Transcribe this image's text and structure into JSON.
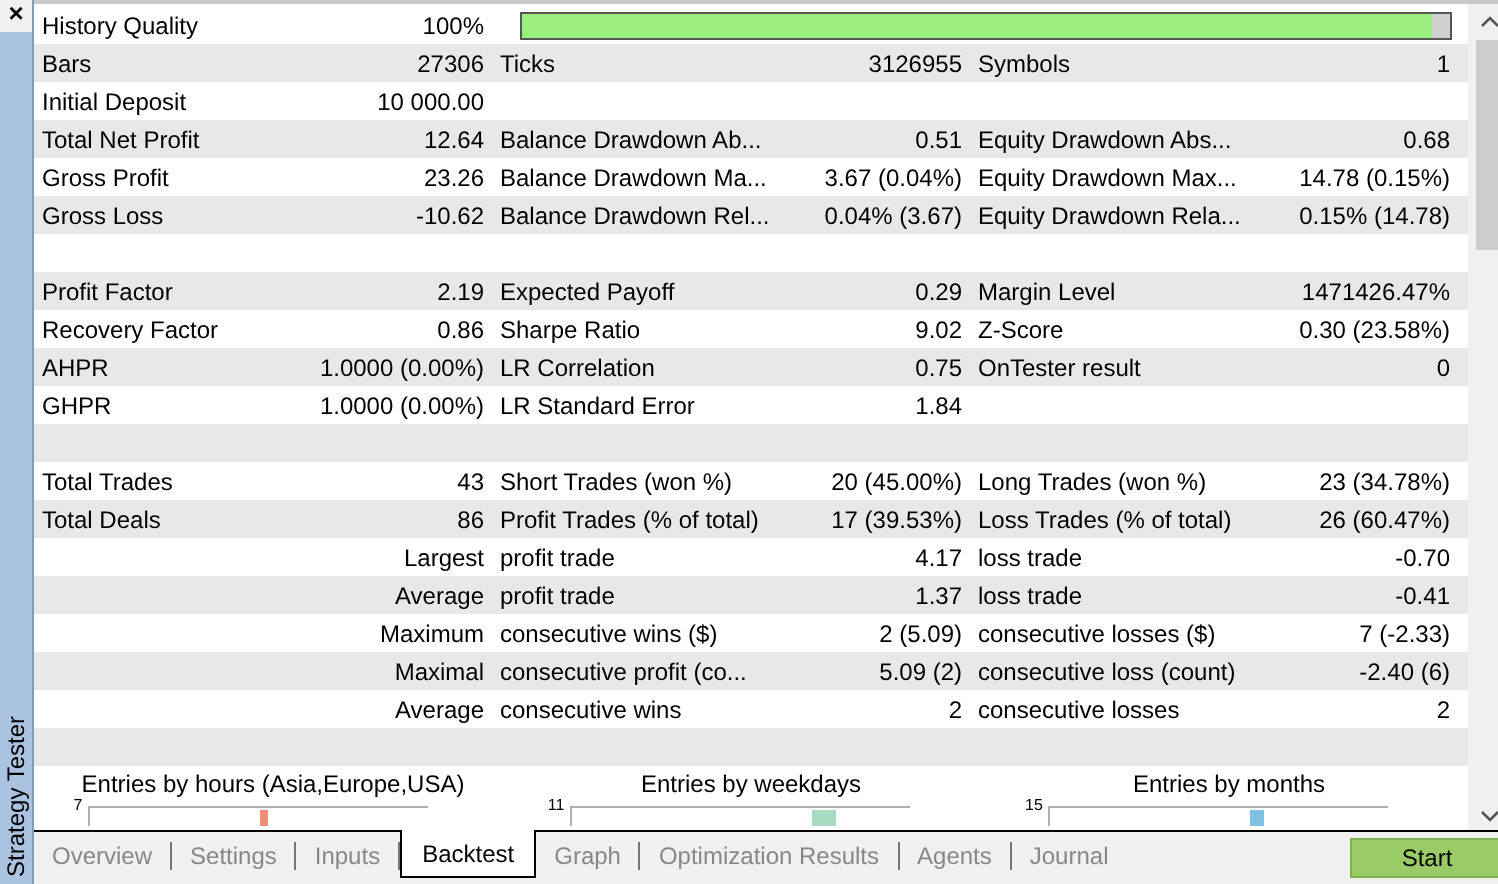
{
  "panel": {
    "title": "Strategy Tester",
    "close": "×"
  },
  "rows": [
    {
      "kind": "quality",
      "label": "History Quality",
      "value": "100%",
      "level": 0.98
    },
    {
      "kind": "stats",
      "cells": [
        {
          "label": "Bars",
          "value": "27306"
        },
        {
          "label": "Ticks",
          "value": "3126955"
        },
        {
          "label": "Symbols",
          "value": "1"
        }
      ]
    },
    {
      "kind": "stats",
      "cells": [
        {
          "label": "Initial Deposit",
          "value": "10 000.00"
        }
      ]
    },
    {
      "kind": "stats",
      "cells": [
        {
          "label": "Total Net Profit",
          "value": "12.64"
        },
        {
          "label": "Balance Drawdown Ab...",
          "value": "0.51"
        },
        {
          "label": "Equity Drawdown Abs...",
          "value": "0.68"
        }
      ]
    },
    {
      "kind": "stats",
      "cells": [
        {
          "label": "Gross Profit",
          "value": "23.26"
        },
        {
          "label": "Balance Drawdown Ma...",
          "value": "3.67 (0.04%)"
        },
        {
          "label": "Equity Drawdown Max...",
          "value": "14.78 (0.15%)"
        }
      ]
    },
    {
      "kind": "stats",
      "cells": [
        {
          "label": "Gross Loss",
          "value": "-10.62"
        },
        {
          "label": "Balance Drawdown Rel...",
          "value": "0.04% (3.67)"
        },
        {
          "label": "Equity Drawdown Rela...",
          "value": "0.15% (14.78)"
        }
      ]
    },
    {
      "kind": "blank"
    },
    {
      "kind": "stats",
      "cells": [
        {
          "label": "Profit Factor",
          "value": "2.19"
        },
        {
          "label": "Expected Payoff",
          "value": "0.29"
        },
        {
          "label": "Margin Level",
          "value": "1471426.47%"
        }
      ]
    },
    {
      "kind": "stats",
      "cells": [
        {
          "label": "Recovery Factor",
          "value": "0.86"
        },
        {
          "label": "Sharpe Ratio",
          "value": "9.02"
        },
        {
          "label": "Z-Score",
          "value": "0.30 (23.58%)"
        }
      ]
    },
    {
      "kind": "stats",
      "cells": [
        {
          "label": "AHPR",
          "value": "1.0000 (0.00%)"
        },
        {
          "label": "LR Correlation",
          "value": "0.75"
        },
        {
          "label": "OnTester result",
          "value": "0"
        }
      ]
    },
    {
      "kind": "stats",
      "cells": [
        {
          "label": "GHPR",
          "value": "1.0000 (0.00%)"
        },
        {
          "label": "LR Standard Error",
          "value": "1.84"
        }
      ]
    },
    {
      "kind": "blank"
    },
    {
      "kind": "stats",
      "cells": [
        {
          "label": "Total Trades",
          "value": "43"
        },
        {
          "label": "Short Trades (won %)",
          "value": "20 (45.00%)"
        },
        {
          "label": "Long Trades (won %)",
          "value": "23 (34.78%)"
        }
      ]
    },
    {
      "kind": "stats",
      "cells": [
        {
          "label": "Total Deals",
          "value": "86"
        },
        {
          "label": "Profit Trades (% of total)",
          "value": "17 (39.53%)"
        },
        {
          "label": "Loss Trades (% of total)",
          "value": "26 (60.47%)"
        }
      ]
    },
    {
      "kind": "stats",
      "cells": [
        {
          "value": "Largest"
        },
        {
          "label": "profit trade",
          "value": "4.17"
        },
        {
          "label": "loss trade",
          "value": "-0.70"
        }
      ]
    },
    {
      "kind": "stats",
      "cells": [
        {
          "value": "Average"
        },
        {
          "label": "profit trade",
          "value": "1.37"
        },
        {
          "label": "loss trade",
          "value": "-0.41"
        }
      ]
    },
    {
      "kind": "stats",
      "cells": [
        {
          "value": "Maximum"
        },
        {
          "label": "consecutive wins ($)",
          "value": "2 (5.09)"
        },
        {
          "label": "consecutive losses ($)",
          "value": "7 (-2.33)"
        }
      ]
    },
    {
      "kind": "stats",
      "cells": [
        {
          "value": "Maximal"
        },
        {
          "label": "consecutive profit (co...",
          "value": "5.09 (2)"
        },
        {
          "label": "consecutive loss (count)",
          "value": "-2.40 (6)"
        }
      ]
    },
    {
      "kind": "stats",
      "cells": [
        {
          "value": "Average"
        },
        {
          "label": "consecutive wins",
          "value": "2"
        },
        {
          "label": "consecutive losses",
          "value": "2"
        }
      ]
    },
    {
      "kind": "blank"
    }
  ],
  "charts": [
    {
      "title": "Entries by hours (Asia,Europe,USA)",
      "tick": "7",
      "color": "#f0907a"
    },
    {
      "title": "Entries by weekdays",
      "tick": "11",
      "color": "#a8dcc0"
    },
    {
      "title": "Entries by months",
      "tick": "15",
      "color": "#80c0e0"
    }
  ],
  "tabs": [
    {
      "label": "Overview",
      "selected": false
    },
    {
      "label": "Settings",
      "selected": false
    },
    {
      "label": "Inputs",
      "selected": false
    },
    {
      "label": "Backtest",
      "selected": true
    },
    {
      "label": "Graph",
      "selected": false
    },
    {
      "label": "Optimization Results",
      "selected": false
    },
    {
      "label": "Agents",
      "selected": false
    },
    {
      "label": "Journal",
      "selected": false
    }
  ],
  "start_button": "Start"
}
